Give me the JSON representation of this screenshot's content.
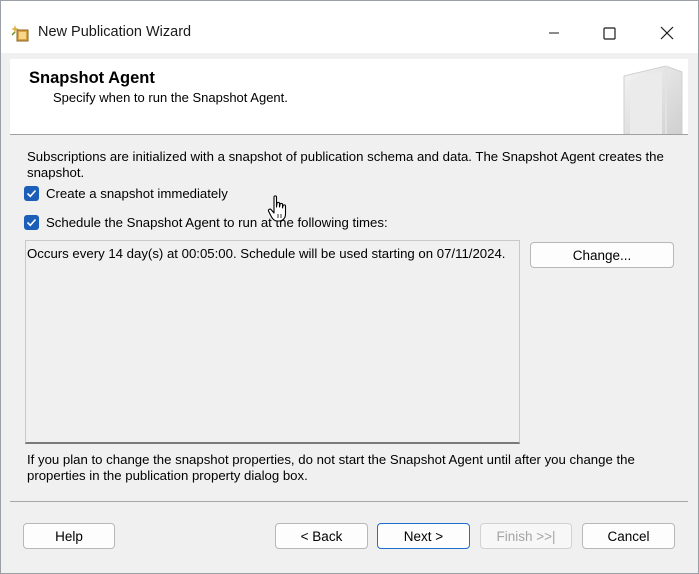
{
  "window": {
    "title": "New Publication Wizard",
    "controls": {
      "minimize": "—",
      "maximize": "☐",
      "close": "✕"
    }
  },
  "banner": {
    "heading": "Snapshot Agent",
    "subheading": "Specify when to run the Snapshot Agent."
  },
  "body": {
    "description": "Subscriptions are initialized with a snapshot of publication schema and data. The Snapshot Agent creates the snapshot.",
    "options": [
      {
        "label": "Create a snapshot immediately",
        "checked": true
      },
      {
        "label": "Schedule the Snapshot Agent to run at the following times:",
        "checked": true
      }
    ],
    "schedule_text": "Occurs every 14 day(s) at 00:05:00. Schedule will be used starting on 07/11/2024.",
    "change_label": "Change...",
    "note": "If you plan to change the snapshot properties, do not start the Snapshot Agent until after you change the properties in the publication property dialog box."
  },
  "footer": {
    "help_label": "Help",
    "back_label": "< Back",
    "next_label": "Next >",
    "finish_label": "Finish >>|",
    "cancel_label": "Cancel"
  },
  "colors": {
    "checkbox": "#1b5fb8",
    "default_button_border": "#1f6fd0",
    "dialog_background": "#f0f0f0"
  },
  "icons": [
    "wizard-app-icon",
    "banner-graphic-icon",
    "check-icon",
    "hand-cursor-icon"
  ]
}
